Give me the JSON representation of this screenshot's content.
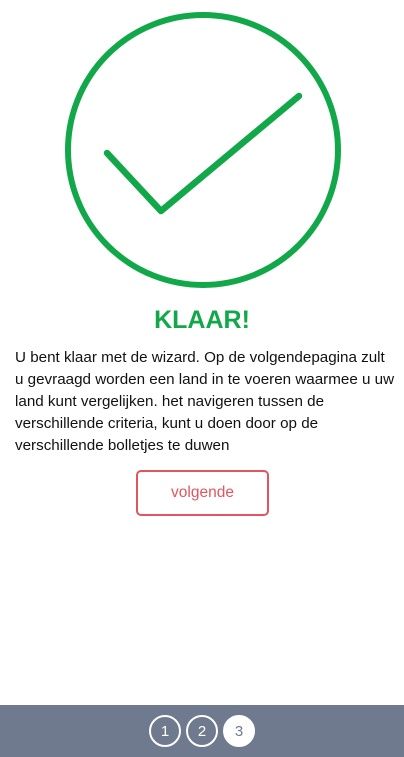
{
  "colors": {
    "success": "#12a84a",
    "accent": "#e05560",
    "footer_bg": "#6f7a8e",
    "active_step_text": "#6f7a8e"
  },
  "icon": "check-circle-icon",
  "title": "KLAAR!",
  "message": "U bent klaar met de wizard. Op de volgendepagina zult u gevraagd worden een land in te voeren waarmee u uw land kunt vergelijken. het navigeren tussen de verschillende criteria, kunt u doen door op de verschillende bolletjes te duwen",
  "next_button": {
    "label": "volgende"
  },
  "steps": [
    {
      "label": "1",
      "active": false
    },
    {
      "label": "2",
      "active": false
    },
    {
      "label": "3",
      "active": true
    }
  ]
}
